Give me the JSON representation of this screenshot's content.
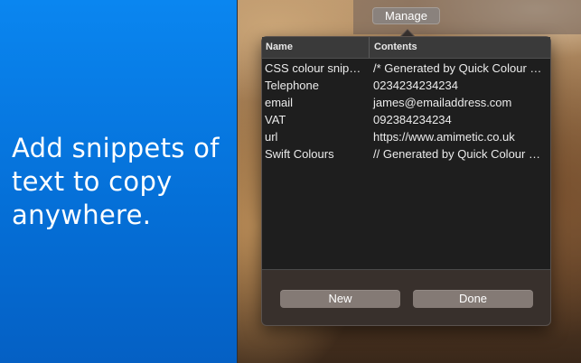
{
  "promo": {
    "headline": "Add snippets of text to copy anywhere."
  },
  "menubar": {
    "manage_label": "Manage"
  },
  "table": {
    "columns": [
      "Name",
      "Contents"
    ],
    "rows": [
      {
        "name": "CSS colour snippets",
        "contents": "/* Generated by Quick Colour Picker */"
      },
      {
        "name": "Telephone",
        "contents": "0234234234234"
      },
      {
        "name": "email",
        "contents": "james@emailaddress.com"
      },
      {
        "name": "VAT",
        "contents": "092384234234"
      },
      {
        "name": "url",
        "contents": "https://www.amimetic.co.uk"
      },
      {
        "name": "Swift Colours",
        "contents": "// Generated by Quick Colour Picker"
      }
    ]
  },
  "buttons": {
    "new_label": "New",
    "done_label": "Done"
  }
}
